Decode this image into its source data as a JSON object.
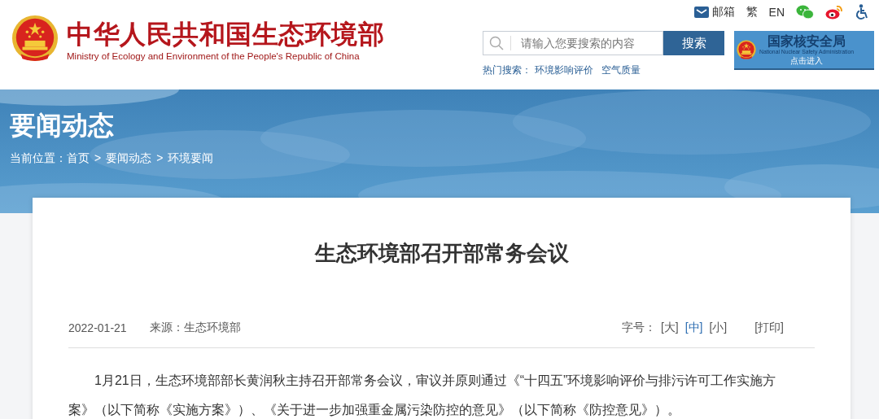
{
  "header": {
    "title": "中华人民共和国生态环境部",
    "subtitle": "Ministry of Ecology and Environment of the People's Republic of China",
    "top_links": [
      {
        "kind": "mail",
        "label": "邮箱"
      },
      {
        "kind": "text",
        "label": "繁"
      },
      {
        "kind": "text",
        "label": "EN"
      },
      {
        "kind": "wechat"
      },
      {
        "kind": "weibo"
      },
      {
        "kind": "accessibility"
      }
    ],
    "search": {
      "placeholder": "请输入您要搜索的内容",
      "button": "搜索"
    },
    "hot_search": {
      "label": "热门搜索：",
      "links": [
        "环境影响评价",
        "空气质量"
      ]
    },
    "nnsa_banner": {
      "title": "国家核安全局",
      "subtitle": "National Nuclear Safety Administration",
      "action": "点击进入"
    }
  },
  "banner": {
    "title": "要闻动态",
    "breadcrumb": {
      "label": "当前位置：",
      "separator": ">",
      "items": [
        "首页",
        "要闻动态",
        "环境要闻"
      ]
    }
  },
  "article": {
    "title": "生态环境部召开部常务会议",
    "date": "2022-01-21",
    "source": "来源：生态环境部",
    "font_size_label": "字号：",
    "font_sizes": [
      {
        "label": "[大]",
        "selected": false
      },
      {
        "label": "[中]",
        "selected": true
      },
      {
        "label": "[小]",
        "selected": false
      }
    ],
    "print": "[打印]",
    "paragraphs": [
      "1月21日，生态环境部部长黄润秋主持召开部常务会议，审议并原则通过《“十四五”环境影响评价与排污许可工作实施方案》（以下简称《实施方案》）、《关于进一步加强重金属污染防控的意见》（以下简称《防控意见》）。"
    ]
  }
}
